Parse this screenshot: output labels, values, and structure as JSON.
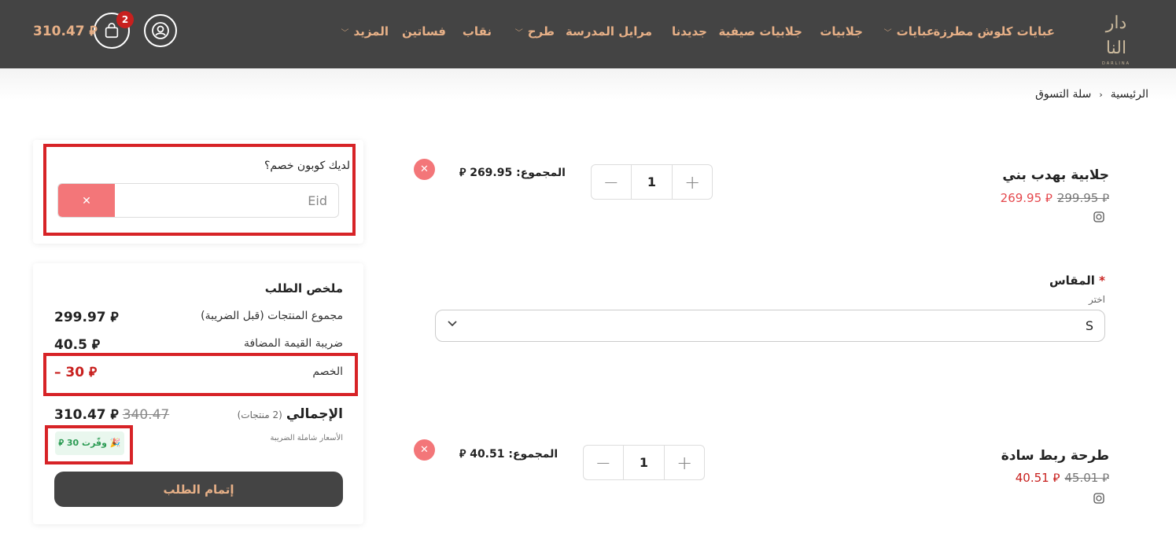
{
  "header": {
    "cart_total": "310.47 ⃁",
    "cart_count": "2",
    "logo_text": "دار النا",
    "logo_small": "DARLINA",
    "nav": [
      {
        "label": "عبايات كلوش مطرزة",
        "has_menu": false
      },
      {
        "label": "عبايات",
        "has_menu": true
      },
      {
        "label": "جلابيات",
        "has_menu": false
      },
      {
        "label": "جلابيات صيفية",
        "has_menu": false
      },
      {
        "label": "جديدنا",
        "has_menu": false
      },
      {
        "label": "مرايل المدرسة",
        "has_menu": false
      },
      {
        "label": "طرح",
        "has_menu": true
      },
      {
        "label": "نقاب",
        "has_menu": false
      },
      {
        "label": "فساتين",
        "has_menu": false
      },
      {
        "label": "المزيد",
        "has_menu": true
      }
    ]
  },
  "breadcrumb": {
    "home": "الرئيسية",
    "current": "سلة التسوق"
  },
  "coupon": {
    "label": "لديك كوبون خصم؟",
    "value": "Eid"
  },
  "summary": {
    "title": "ملخص الطلب",
    "subtotal_label": "مجموع المنتجات (قبل الضريبة)",
    "subtotal_value": "299.97 ⃁",
    "vat_label": "ضريبة القيمة المضافة",
    "vat_value": "40.5 ⃁",
    "discount_label": "الخصم",
    "discount_value": "– 30 ⃁",
    "total_label": "الإجمالي",
    "total_count": "(2 منتجات)",
    "total_value": "310.47 ⃁",
    "total_old": "340.47",
    "tax_note": "الأسعار شاملة الضريبة",
    "saved": "🎉 وفّرت 30 ⃁",
    "checkout": "إتمام الطلب"
  },
  "items": [
    {
      "name": "جلابية بهدب بني",
      "price_new": "269.95 ⃁",
      "price_old": "299.95 ⃁",
      "line_total_label": "المجموع:",
      "line_total_value": "269.95 ⃁",
      "qty": "1"
    },
    {
      "name": "طرحة ربط سادة",
      "price_new": "40.51 ⃁",
      "price_old": "45.01 ⃁",
      "line_total_label": "المجموع:",
      "line_total_value": "40.51 ⃁",
      "qty": "1"
    }
  ],
  "size_option": {
    "label": "المقاس",
    "required_mark": "*",
    "hint": "اختر",
    "value": "S"
  },
  "colors": {
    "header_bg": "#444444",
    "accent": "#e7b087",
    "danger": "#d72327",
    "remove": "#f37679",
    "saved_bg": "#e9f7ee",
    "saved_text": "#2c9b54"
  }
}
